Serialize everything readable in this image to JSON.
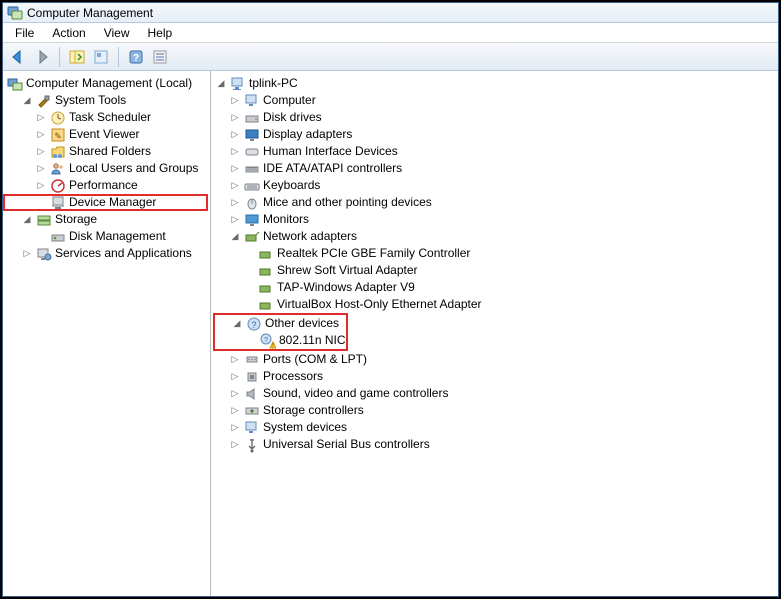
{
  "title": "Computer Management",
  "menu": {
    "file": "File",
    "action": "Action",
    "view": "View",
    "help": "Help"
  },
  "left_tree": {
    "root": "Computer Management (Local)",
    "systools": "System Tools",
    "task": "Task Scheduler",
    "event": "Event Viewer",
    "shared": "Shared Folders",
    "users": "Local Users and Groups",
    "perf": "Performance",
    "devmgr": "Device Manager",
    "storage": "Storage",
    "diskmgmt": "Disk Management",
    "services": "Services and Applications"
  },
  "right_tree": {
    "root": "tplink-PC",
    "computer": "Computer",
    "disk": "Disk drives",
    "display": "Display adapters",
    "hid": "Human Interface Devices",
    "ide": "IDE ATA/ATAPI controllers",
    "kbd": "Keyboards",
    "mice": "Mice and other pointing devices",
    "monitors": "Monitors",
    "net": "Network adapters",
    "net1": "Realtek PCIe GBE Family Controller",
    "net2": "Shrew Soft Virtual Adapter",
    "net3": "TAP-Windows Adapter V9",
    "net4": "VirtualBox Host-Only Ethernet Adapter",
    "other": "Other devices",
    "other1": "802.11n NIC",
    "ports": "Ports (COM & LPT)",
    "proc": "Processors",
    "sound": "Sound, video and game controllers",
    "storctrl": "Storage controllers",
    "sysdev": "System devices",
    "usb": "Universal Serial Bus controllers"
  }
}
